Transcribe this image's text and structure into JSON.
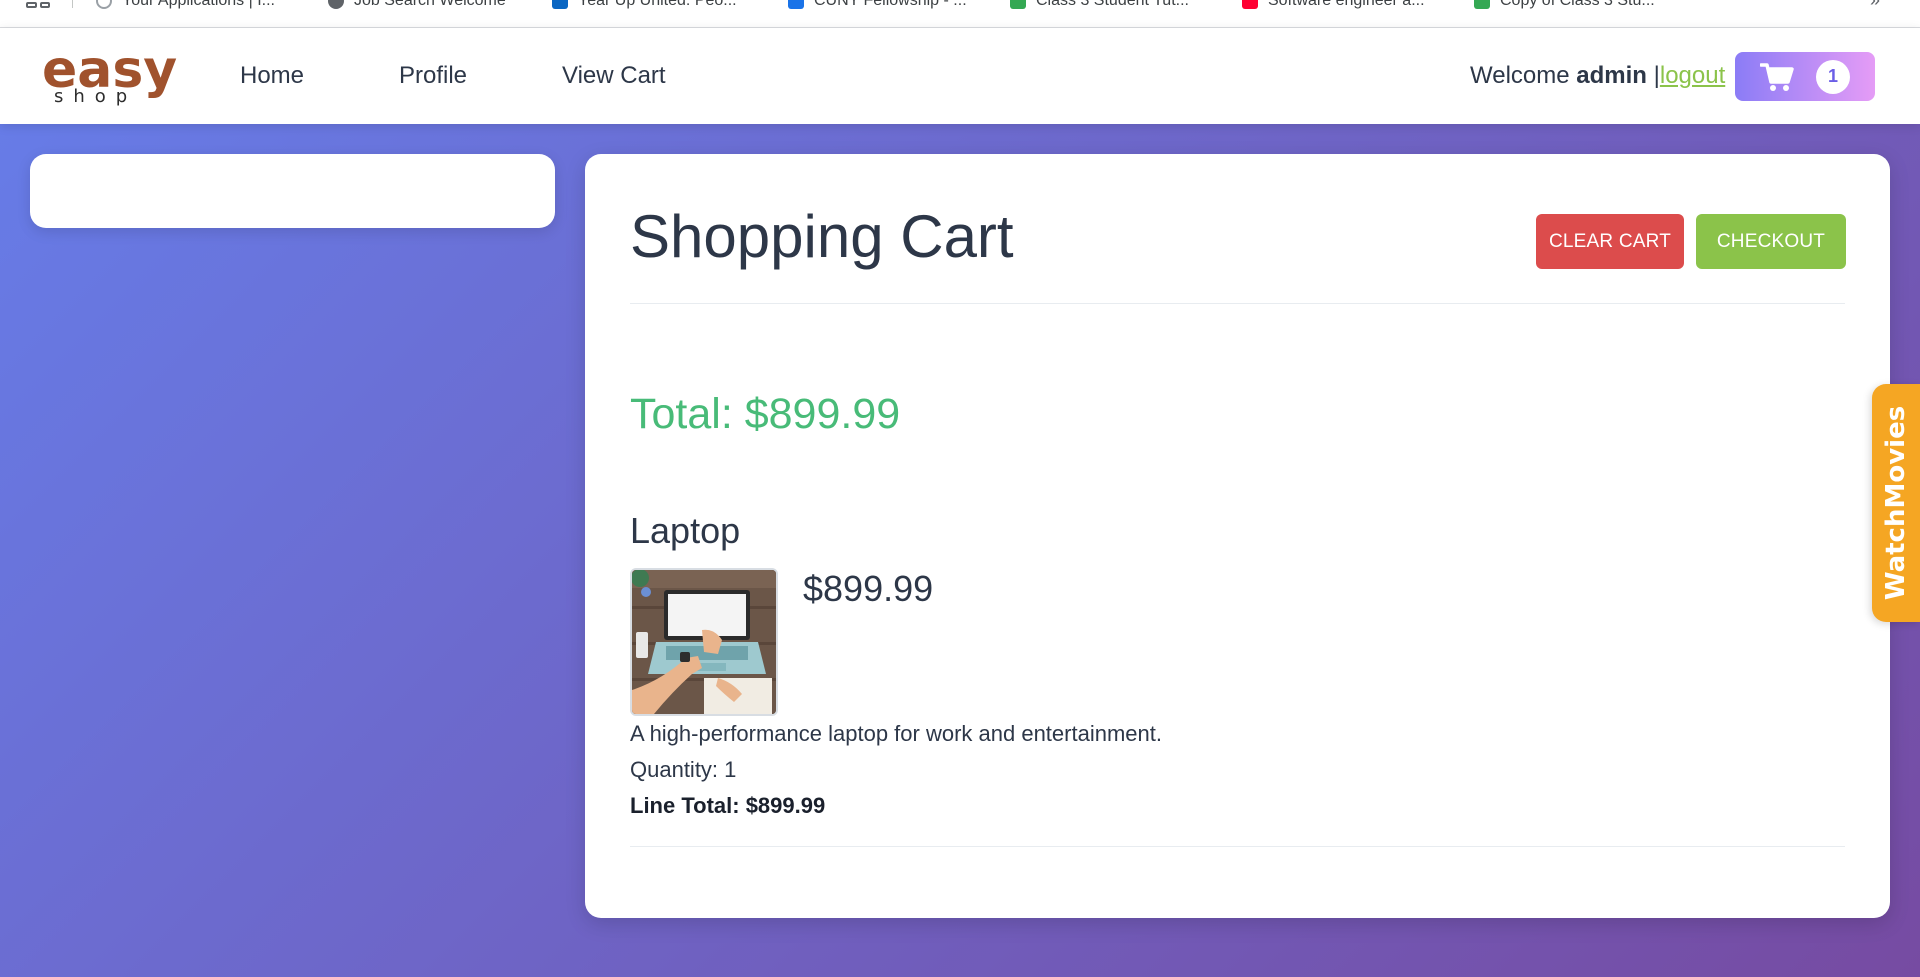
{
  "browser": {
    "bookmarks": [
      {
        "label": "Your Applications | I...",
        "icon": "globe-icon"
      },
      {
        "label": "Job Search Welcome",
        "icon": "globe-icon"
      },
      {
        "label": "Year Up United: Peo...",
        "icon": "linkedin-icon"
      },
      {
        "label": "CUNY Fellowship - ...",
        "icon": "doc-icon"
      },
      {
        "label": "Class 3 Student Tut...",
        "icon": "sheets-icon"
      },
      {
        "label": "Software engineer a...",
        "icon": "youtube-icon"
      },
      {
        "label": "Copy of Class 3 Stu...",
        "icon": "sheets-icon"
      }
    ],
    "more_label": "»"
  },
  "header": {
    "logo_main": "easy",
    "logo_sub": "shop",
    "nav": [
      "Home",
      "Profile",
      "View Cart"
    ],
    "welcome_prefix": "Welcome",
    "username": "admin",
    "separator": "|",
    "logout_label": "logout",
    "cart_count": "1"
  },
  "cart": {
    "title": "Shopping Cart",
    "clear_label": "CLEAR CART",
    "checkout_label": "CHECKOUT",
    "total": "Total: $899.99",
    "items": [
      {
        "name": "Laptop",
        "price": "$899.99",
        "description": "A high-performance laptop for work and entertainment.",
        "quantity": "Quantity: 1",
        "line_total": "Line Total: $899.99"
      }
    ]
  },
  "side_tab": {
    "label": "WatchMovies"
  },
  "colors": {
    "accent_green": "#48bb78",
    "checkout_green": "#8bc34a",
    "clear_red": "#dc4c4c",
    "logo_brown": "#a0522d",
    "gradient_start": "#667eea",
    "gradient_end": "#764ba2"
  }
}
